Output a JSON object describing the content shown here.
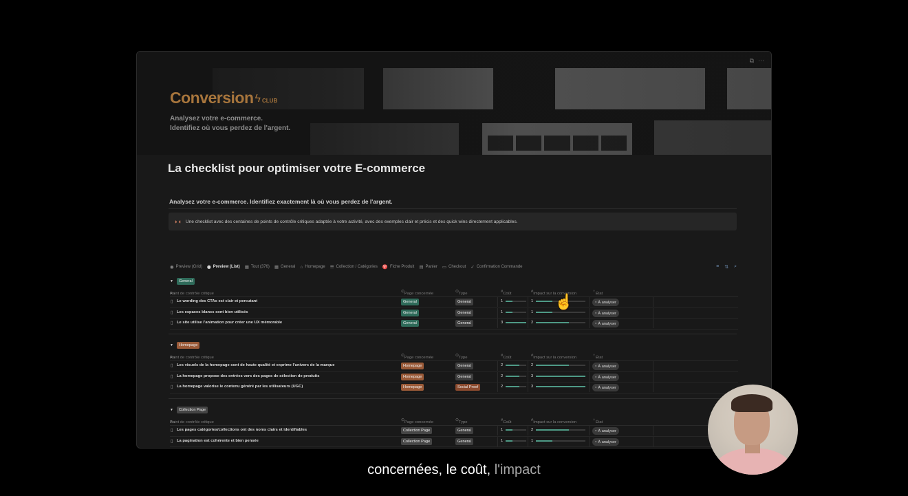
{
  "cover": {
    "brand_name": "Conversion",
    "brand_suffix": "CLUB",
    "line1": "Analysez votre e-commerce.",
    "line2": "Identifiez où vous perdez de l'argent."
  },
  "page": {
    "title": "La checklist pour optimiser votre E-commerce",
    "subtitle": "Analysez votre e-commerce. Identifiez exactement là où vous perdez de l'argent.",
    "callout": "Une checklist avec des centaines de points de contrôle critiques adaptée à votre activité, avec des exemples clair et précis et des quick wins directement applicables."
  },
  "tabs": [
    {
      "label": "Preview (Grid)",
      "icon": "eye-icon"
    },
    {
      "label": "Preview (List)",
      "icon": "eye-icon",
      "active": true
    },
    {
      "label": "Tout (376)",
      "icon": "table-icon"
    },
    {
      "label": "General",
      "icon": "table-icon"
    },
    {
      "label": "Homepage",
      "icon": "home-icon"
    },
    {
      "label": "Collection / Catégories",
      "icon": "list-icon"
    },
    {
      "label": "Fiche Produit",
      "icon": "shirt-icon"
    },
    {
      "label": "Panier",
      "icon": "cart-icon"
    },
    {
      "label": "Checkout",
      "icon": "card-icon"
    },
    {
      "label": "Confirmation Commande",
      "icon": "check-circle-icon"
    }
  ],
  "columns": {
    "name": "Point de contrôle critique",
    "name_prefix": "Aa",
    "page": "Page concernée",
    "type": "Type",
    "cost": "Coût",
    "impact": "Impact sur la conversion",
    "etat": "État"
  },
  "groups": [
    {
      "label": "General",
      "rows": [
        {
          "name": "Le wording des CTAs est clair et percutant",
          "page": "General",
          "type": "General",
          "cost": 1,
          "impact": 1,
          "etat": "À analyser"
        },
        {
          "name": "Les espaces blancs sont bien utilisés",
          "page": "General",
          "type": "General",
          "cost": 1,
          "impact": 1,
          "etat": "À analyser"
        },
        {
          "name": "Le site utilise l'animation pour créer une UX mémorable",
          "page": "General",
          "type": "General",
          "cost": 3,
          "impact": 2,
          "etat": "À analyser"
        }
      ]
    },
    {
      "label": "Homepage",
      "rows": [
        {
          "name": "Les visuels de la homepage sont de haute qualité et exprime l'univers de la marque",
          "page": "Homepage",
          "type": "General",
          "cost": 2,
          "impact": 2,
          "etat": "À analyser"
        },
        {
          "name": "La homepage propose des entrées vers des pages de sélection de produits",
          "page": "Homepage",
          "type": "General",
          "cost": 2,
          "impact": 3,
          "etat": "À analyser"
        },
        {
          "name": "La homepage valorise le contenu généré par les utilisateurs (UGC)",
          "page": "Homepage",
          "type": "Social Proof",
          "cost": 2,
          "impact": 3,
          "etat": "À analyser"
        }
      ]
    },
    {
      "label": "Collection Page",
      "rows": [
        {
          "name": "Les pages catégories/collections ont des noms clairs et identifiables",
          "page": "Collection Page",
          "type": "General",
          "cost": 1,
          "impact": 2,
          "etat": "À analyser"
        },
        {
          "name": "La pagination est cohérente et bien pensée",
          "page": "Collection Page",
          "type": "General",
          "cost": 1,
          "impact": 1,
          "etat": "À analyser"
        }
      ]
    }
  ],
  "caption": {
    "main": "concernées, le coût,",
    "dim": "l'impact"
  }
}
